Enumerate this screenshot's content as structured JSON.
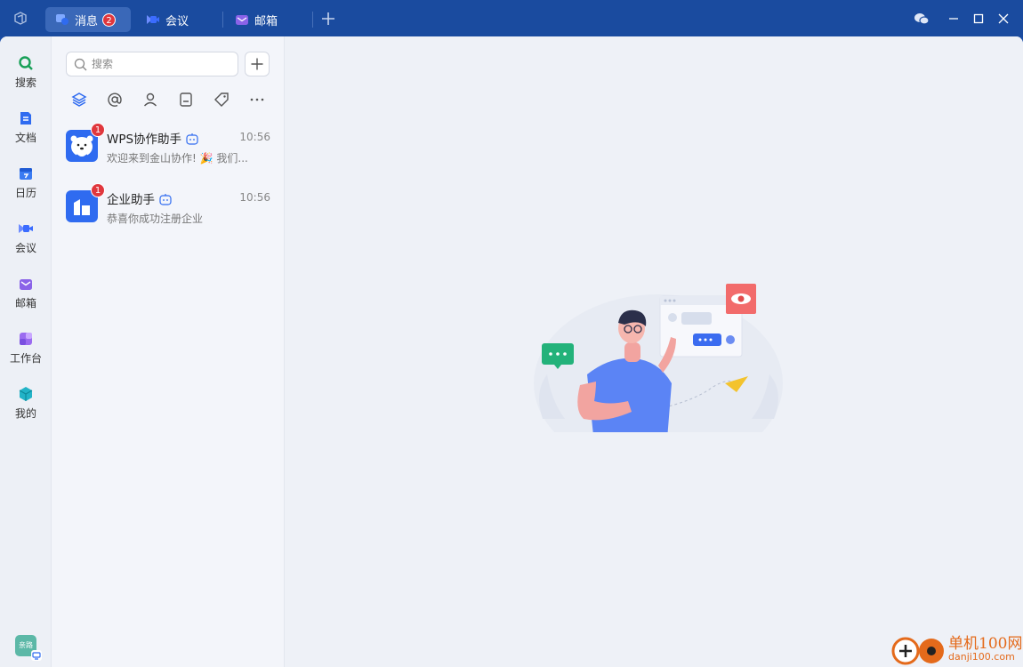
{
  "titlebar": {
    "tabs": [
      {
        "label": "消息",
        "badge": "2",
        "active": true
      },
      {
        "label": "会议",
        "active": false
      },
      {
        "label": "邮箱",
        "active": false
      }
    ]
  },
  "rail": {
    "items": [
      {
        "label": "搜索",
        "icon": "search-icon"
      },
      {
        "label": "文档",
        "icon": "document-icon"
      },
      {
        "label": "日历",
        "icon": "calendar-icon"
      },
      {
        "label": "会议",
        "icon": "meeting-icon"
      },
      {
        "label": "邮箱",
        "icon": "mail-icon"
      },
      {
        "label": "工作台",
        "icon": "workbench-icon"
      },
      {
        "label": "我的",
        "icon": "cube-icon"
      }
    ],
    "avatar_text": "亲路"
  },
  "messages": {
    "search_placeholder": "搜索",
    "conversations": [
      {
        "name": "WPS协作助手",
        "time": "10:56",
        "preview": "欢迎来到金山协作! 🎉 我们...",
        "badge": "1"
      },
      {
        "name": "企业助手",
        "time": "10:56",
        "preview": "恭喜你成功注册企业",
        "badge": "1"
      }
    ]
  },
  "watermark": {
    "title": "单机100网",
    "url": "danji100.com"
  },
  "colors": {
    "titlebar": "#1a4b9f",
    "accent": "#2f6bf0",
    "badge": "#e0373d"
  }
}
